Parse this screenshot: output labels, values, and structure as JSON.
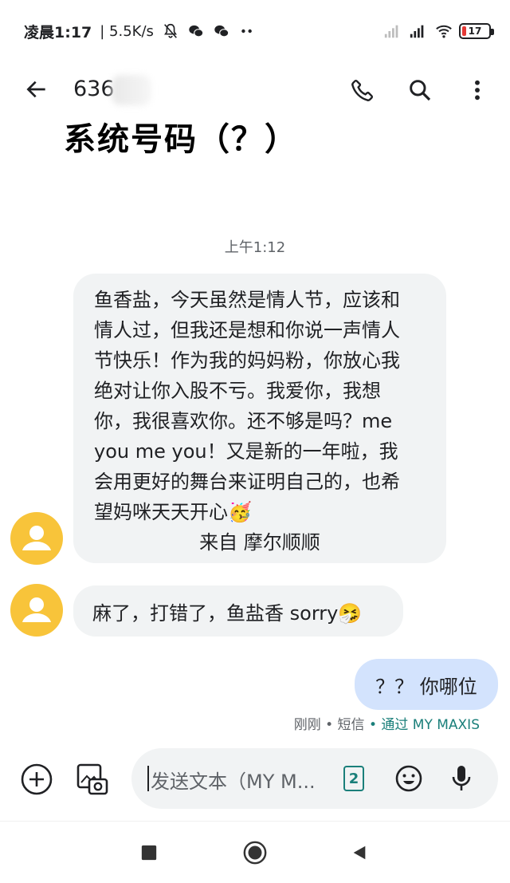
{
  "status_bar": {
    "time": "凌晨1:17",
    "speed": "| 5.5K/s",
    "battery": "17",
    "battery_level": 0.17
  },
  "header": {
    "contact_name": "636",
    "annotation": "系统号码（？）"
  },
  "conversation": {
    "timestamp": "上午1:12",
    "messages": [
      {
        "direction": "incoming",
        "text": "鱼香盐，今天虽然是情人节，应该和\n情人过，但我还是想和你说一声情人\n节快乐！作为我的妈妈粉，你放心我\n绝对让你入股不亏。我爱你，我想\n你，我很喜欢你。还不够是吗？me\nyou me you！又是新的一年啦，我\n会用更好的舞台来证明自己的，也希\n望妈咪天天开心🥳",
        "signature": "来自 摩尔顺顺"
      },
      {
        "direction": "incoming",
        "text": "麻了，打错了，鱼盐香 sorry🤧"
      },
      {
        "direction": "outgoing",
        "text": "？？ 你哪位"
      }
    ],
    "meta": {
      "time": "刚刚",
      "sep": " • ",
      "type": "短信",
      "via": " • 通过 MY MAXIS"
    }
  },
  "compose": {
    "placeholder": "发送文本（MY M...",
    "sim": "2"
  },
  "colors": {
    "avatar": "#f8c43a",
    "bubble_in": "#f1f3f4",
    "bubble_out": "#d3e3fd",
    "accent": "#1a7f7a",
    "battery_low": "#e53935"
  },
  "icons": {
    "back": "arrow-left-icon",
    "call": "phone-icon",
    "search": "search-icon",
    "more": "more-vert-icon",
    "add": "add-circle-icon",
    "media": "gallery-camera-icon",
    "emoji": "emoji-icon",
    "mic": "mic-icon",
    "nav_recents": "square-icon",
    "nav_home": "circle-icon",
    "nav_back": "triangle-icon"
  }
}
